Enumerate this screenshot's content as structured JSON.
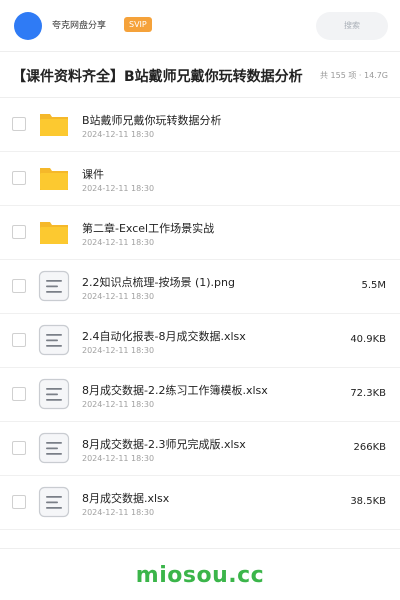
{
  "header": {
    "brand": "夸克网盘分享",
    "badge": "SVIP",
    "search_label": "搜索"
  },
  "folder_title": "【课件资料齐全】B站戴师兄戴你玩转数据分析",
  "folder_meta": "共 155 项 · 14.7G",
  "files": [
    {
      "name": "B站戴师兄戴你玩转数据分析",
      "date": "2024-12-11 18:30",
      "size": "",
      "type": "folder"
    },
    {
      "name": "课件",
      "date": "2024-12-11 18:30",
      "size": "",
      "type": "folder"
    },
    {
      "name": "第二章-Excel工作场景实战",
      "date": "2024-12-11 18:30",
      "size": "",
      "type": "folder"
    },
    {
      "name": "2.2知识点梳理-按场景 (1).png",
      "date": "2024-12-11 18:30",
      "size": "5.5M",
      "type": "file"
    },
    {
      "name": "2.4自动化报表-8月成交数据.xlsx",
      "date": "2024-12-11 18:30",
      "size": "40.9KB",
      "type": "file"
    },
    {
      "name": "8月成交数据-2.2练习工作簿模板.xlsx",
      "date": "2024-12-11 18:30",
      "size": "72.3KB",
      "type": "file"
    },
    {
      "name": "8月成交数据-2.3师兄完成版.xlsx",
      "date": "2024-12-11 18:30",
      "size": "266KB",
      "type": "file"
    },
    {
      "name": "8月成交数据.xlsx",
      "date": "2024-12-11 18:30",
      "size": "38.5KB",
      "type": "file"
    }
  ],
  "watermark": "miosou.cc",
  "colors": {
    "avatar": "#2f7bf5",
    "badge": "#f5a23a",
    "folder": "#fcc930",
    "watermark": "#3bb54a"
  },
  "icons": {
    "folder": "folder-icon",
    "file": "document-icon"
  }
}
